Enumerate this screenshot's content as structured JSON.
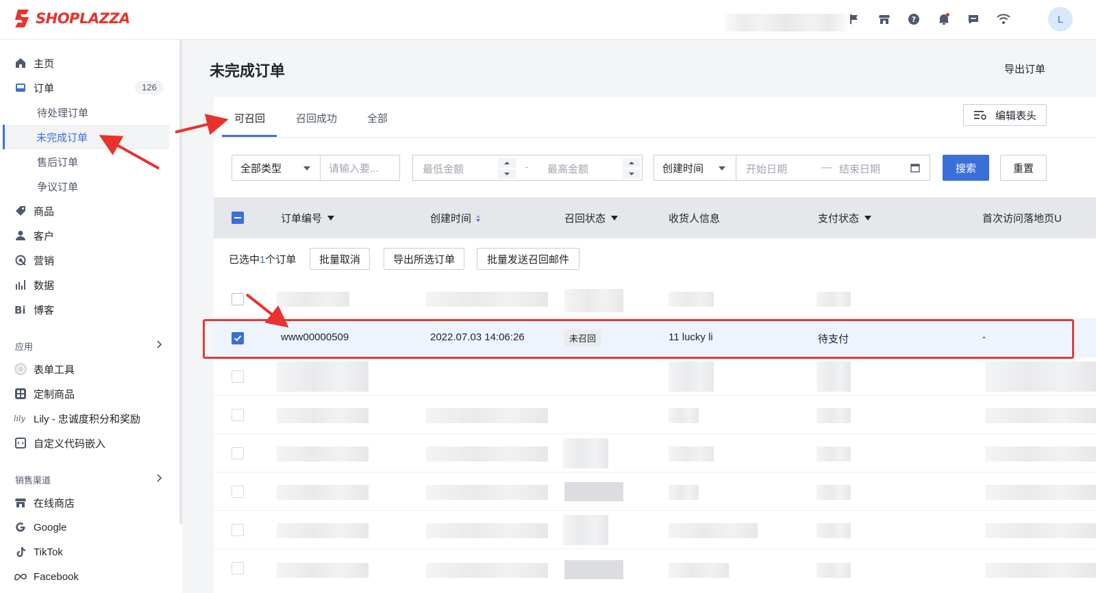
{
  "header": {
    "logo_text": "SHOPLAZZA",
    "icons": [
      "flag-icon",
      "store-icon",
      "help-icon",
      "bell-icon",
      "message-icon",
      "wifi-icon"
    ],
    "avatar_letter": "L",
    "brand_color": "#e8322d",
    "accent_color": "#3b6fd8"
  },
  "sidebar": {
    "items": [
      {
        "label": "主页",
        "icon": "home-icon"
      },
      {
        "label": "订单",
        "icon": "inbox-icon",
        "badge": "126"
      },
      {
        "label": "待处理订单"
      },
      {
        "label": "未完成订单"
      },
      {
        "label": "售后订单"
      },
      {
        "label": "争议订单"
      },
      {
        "label": "商品",
        "icon": "tag-icon"
      },
      {
        "label": "客户",
        "icon": "user-icon"
      },
      {
        "label": "营销",
        "icon": "target-icon"
      },
      {
        "label": "数据",
        "icon": "bar-chart-icon"
      },
      {
        "label": "博客",
        "icon": "blog-icon"
      }
    ],
    "apps_title": "应用",
    "apps": [
      {
        "label": "表单工具",
        "icon": "form-icon"
      },
      {
        "label": "定制商品",
        "icon": "grid-icon"
      },
      {
        "label": "Lily - 忠诚度积分和奖励",
        "icon": "lily-icon"
      },
      {
        "label": "自定义代码嵌入",
        "icon": "code-icon"
      }
    ],
    "channels_title": "销售渠道",
    "channels": [
      {
        "label": "在线商店",
        "icon": "store-icon"
      },
      {
        "label": "Google",
        "icon": "google-icon"
      },
      {
        "label": "TikTok",
        "icon": "tiktok-icon"
      },
      {
        "label": "Facebook",
        "icon": "meta-icon"
      }
    ]
  },
  "page": {
    "title": "未完成订单",
    "export_label": "导出订单"
  },
  "tabs": [
    {
      "label": "可召回",
      "active": true
    },
    {
      "label": "召回成功"
    },
    {
      "label": "全部"
    }
  ],
  "toolbar": {
    "edit_header_label": "编辑表头"
  },
  "filters": {
    "type_value": "全部类型",
    "keyword_placeholder": "请输入要...",
    "min_amount_placeholder": "最低金额",
    "range_sep": "-",
    "max_amount_placeholder": "最高金额",
    "date_field_value": "创建时间",
    "start_date_placeholder": "开始日期",
    "date_sep": "—",
    "end_date_placeholder": "结束日期",
    "search_label": "搜索",
    "reset_label": "重置"
  },
  "table": {
    "columns": [
      "订单编号",
      "创建时间",
      "召回状态",
      "收货人信息",
      "支付状态",
      "首次访问落地页U"
    ],
    "bulk": {
      "prefix": "已选中",
      "count": "1",
      "suffix": "个订单",
      "actions": [
        "批量取消",
        "导出所选订单",
        "批量发送召回邮件"
      ]
    },
    "selected_row": {
      "order_id": "www00000509",
      "created": "2022.07.03 14:06:26",
      "recall_status": "未召回",
      "recipient": "11 lucky li",
      "payment_status": "待支付",
      "landing": "-"
    }
  }
}
